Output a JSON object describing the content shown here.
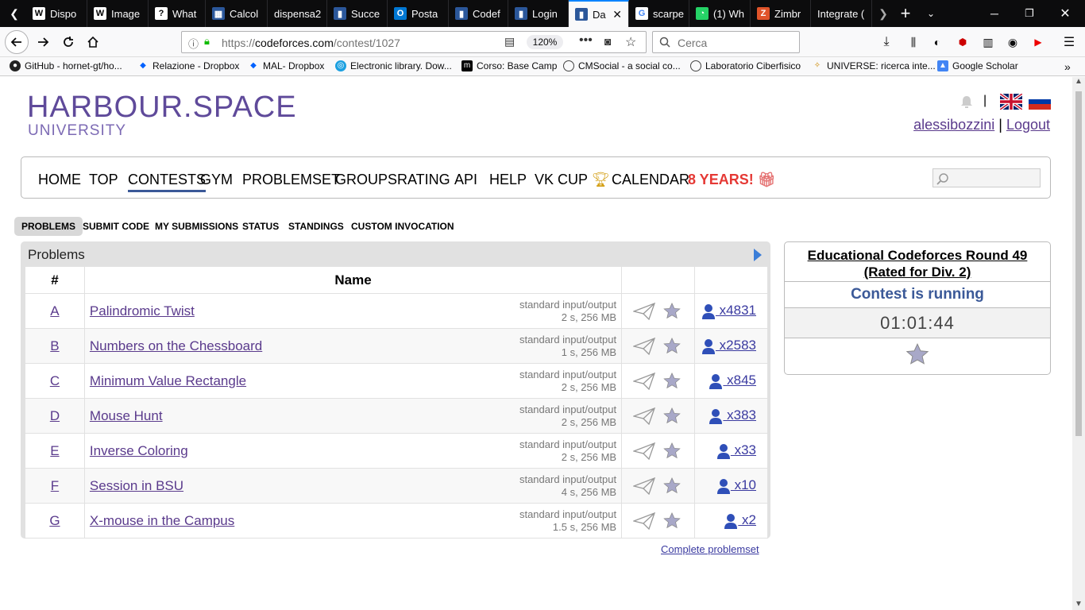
{
  "browser": {
    "tabs": [
      {
        "label": "Dispo",
        "icon": "W"
      },
      {
        "label": "Image",
        "icon": "W"
      },
      {
        "label": "What",
        "icon": "?"
      },
      {
        "label": "Calcol",
        "icon": "▦"
      },
      {
        "label": "dispensa2",
        "icon": ""
      },
      {
        "label": "Succe",
        "icon": "▮"
      },
      {
        "label": "Posta",
        "icon": "O"
      },
      {
        "label": "Codef",
        "icon": "▮"
      },
      {
        "label": "Login",
        "icon": "▮"
      },
      {
        "label": "Da",
        "icon": "▮"
      },
      {
        "label": "scarpe",
        "icon": "G"
      },
      {
        "label": "(1) Wh",
        "icon": "◔"
      },
      {
        "label": "Zimbr",
        "icon": "Z"
      },
      {
        "label": "Integrate (",
        "icon": ""
      }
    ],
    "url_prefix": "https://",
    "url_domain": "codeforces.com",
    "url_path": "/contest/1027",
    "zoom": "120%",
    "search_placeholder": "Cerca",
    "bookmarks": [
      "GitHub - hornet-gt/ho...",
      "Relazione - Dropbox",
      "MAL- Dropbox",
      "Electronic library. Dow...",
      "Corso: Base Camp",
      "CMSocial - a social co...",
      "Laboratorio Ciberfisico",
      "UNIVERSE: ricerca inte...",
      "Google Scholar"
    ]
  },
  "header": {
    "logo_line1": "HARBOUR.SPACE",
    "logo_line2": "UNIVERSITY",
    "username": "alessibozzini",
    "separator": "|",
    "logout": "Logout"
  },
  "menu": {
    "items": [
      "HOME",
      "TOP",
      "CONTESTS",
      "GYM",
      "PROBLEMSET",
      "GROUPS",
      "RATING",
      "API",
      "HELP",
      "VK CUP",
      "CALENDAR"
    ],
    "years": "8 YEARS!"
  },
  "subnav": [
    "PROBLEMS",
    "SUBMIT CODE",
    "MY SUBMISSIONS",
    "STATUS",
    "STANDINGS",
    "CUSTOM INVOCATION"
  ],
  "problems": {
    "title": "Problems",
    "col_index": "#",
    "col_name": "Name",
    "rows": [
      {
        "idx": "A",
        "name": "Palindromic Twist",
        "io": "standard input/output",
        "limits": "2 s, 256 MB",
        "solved": " x4831"
      },
      {
        "idx": "B",
        "name": "Numbers on the Chessboard",
        "io": "standard input/output",
        "limits": "1 s, 256 MB",
        "solved": " x2583"
      },
      {
        "idx": "C",
        "name": "Minimum Value Rectangle",
        "io": "standard input/output",
        "limits": "2 s, 256 MB",
        "solved": " x845"
      },
      {
        "idx": "D",
        "name": "Mouse Hunt",
        "io": "standard input/output",
        "limits": "2 s, 256 MB",
        "solved": " x383"
      },
      {
        "idx": "E",
        "name": "Inverse Coloring",
        "io": "standard input/output",
        "limits": "2 s, 256 MB",
        "solved": " x33"
      },
      {
        "idx": "F",
        "name": "Session in BSU",
        "io": "standard input/output",
        "limits": "4 s, 256 MB",
        "solved": " x10"
      },
      {
        "idx": "G",
        "name": "X-mouse in the Campus",
        "io": "standard input/output",
        "limits": "1.5 s, 256 MB",
        "solved": " x2"
      }
    ],
    "complete_link": "Complete problemset"
  },
  "contest": {
    "name": "Educational Codeforces Round 49 (Rated for Div. 2)",
    "status": "Contest is running",
    "timer": "01:01:44"
  },
  "colors": {
    "accent": "#3b5998",
    "link": "#5a3a8c",
    "years": "#e53935",
    "logo": "#5f4a9a"
  }
}
